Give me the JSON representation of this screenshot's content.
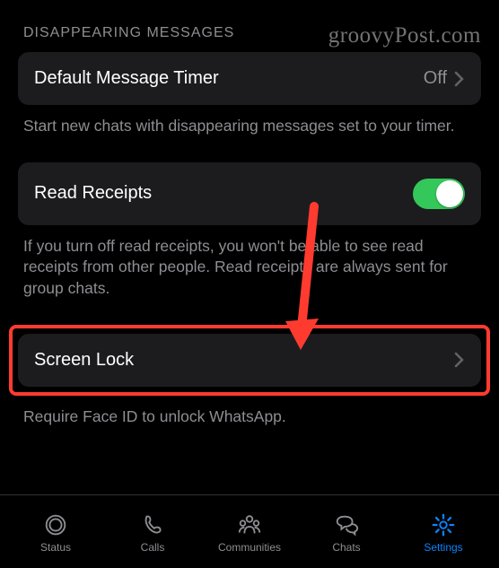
{
  "watermark": "groovyPost.com",
  "section_header": "DISAPPEARING MESSAGES",
  "default_timer": {
    "label": "Default Message Timer",
    "value": "Off",
    "footer": "Start new chats with disappearing messages set to your timer."
  },
  "read_receipts": {
    "label": "Read Receipts",
    "footer": "If you turn off read receipts, you won't be able to see read receipts from other people. Read receipts are always sent for group chats."
  },
  "screen_lock": {
    "label": "Screen Lock",
    "footer": "Require Face ID to unlock WhatsApp."
  },
  "tabs": {
    "status": "Status",
    "calls": "Calls",
    "communities": "Communities",
    "chats": "Chats",
    "settings": "Settings"
  }
}
